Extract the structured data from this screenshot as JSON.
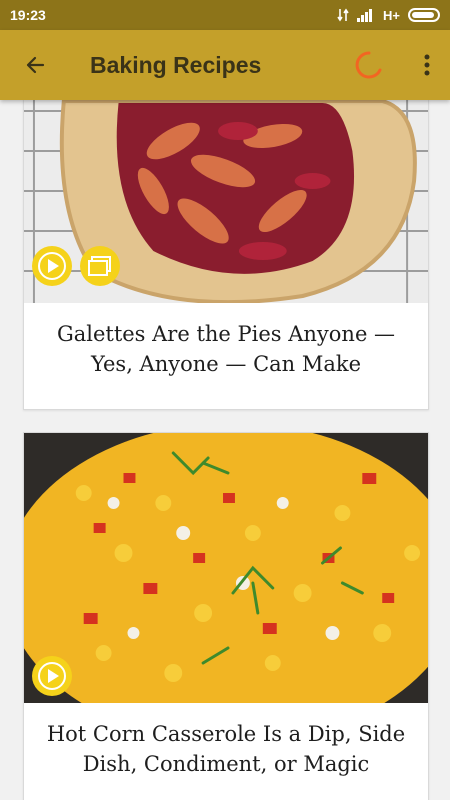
{
  "status_bar": {
    "time": "19:23",
    "network": "H+"
  },
  "app_bar": {
    "title": "Baking Recipes",
    "back_icon": "arrow-back-icon",
    "loading_icon": "loading-spinner-icon",
    "menu_icon": "more-vert-icon",
    "accent_color": "#c4a02a",
    "spinner_color": "#f26522"
  },
  "feed": {
    "cards": [
      {
        "title": "Galettes Are the Pies Anyone — Yes, Anyone — Can Make",
        "badges": [
          "play-icon",
          "gallery-icon"
        ]
      },
      {
        "title": "Hot Corn Casserole Is a Dip, Side Dish, Condiment, or Magic",
        "badges": [
          "play-icon"
        ]
      }
    ]
  }
}
